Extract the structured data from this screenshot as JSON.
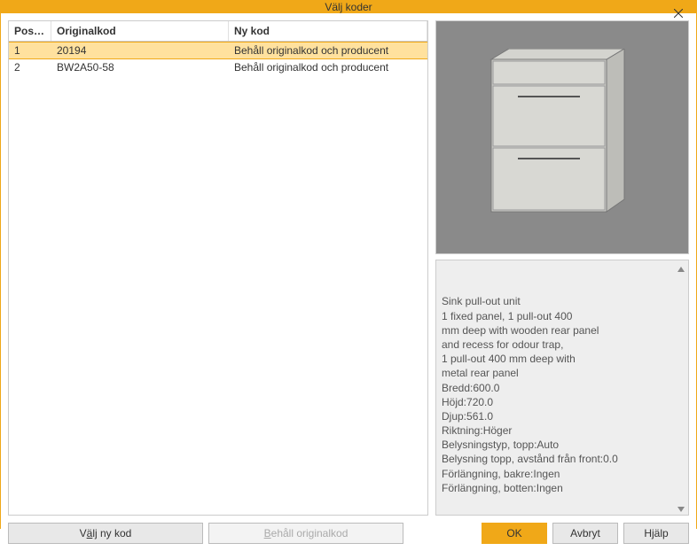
{
  "title": "Välj koder",
  "columns": {
    "position": "Positi…",
    "originalkod": "Originalkod",
    "nykod": "Ny kod"
  },
  "rows": [
    {
      "pos": "1",
      "orig": "20194",
      "ny": "Behåll originalkod och producent",
      "selected": true
    },
    {
      "pos": "2",
      "orig": "BW2A50-58",
      "ny": "Behåll originalkod och producent",
      "selected": false
    }
  ],
  "info": "Sink pull-out unit\n1 fixed panel, 1 pull-out 400\nmm deep with wooden rear panel\nand recess for odour trap,\n1 pull-out 400 mm deep with\nmetal rear panel\nBredd:600.0\nHöjd:720.0\nDjup:561.0\nRiktning:Höger\nBelysningstyp, topp:Auto\nBelysning topp, avstånd från front:0.0\nFörlängning, bakre:Ingen\nFörlängning, botten:Ingen",
  "buttons": {
    "valj_ny_kod_pre": "V",
    "valj_ny_kod_u": "ä",
    "valj_ny_kod_post": "lj ny kod",
    "behall_u": "B",
    "behall_post": "ehåll originalkod",
    "ok": "OK",
    "avbryt": "Avbryt",
    "hjalp": "Hjälp"
  }
}
